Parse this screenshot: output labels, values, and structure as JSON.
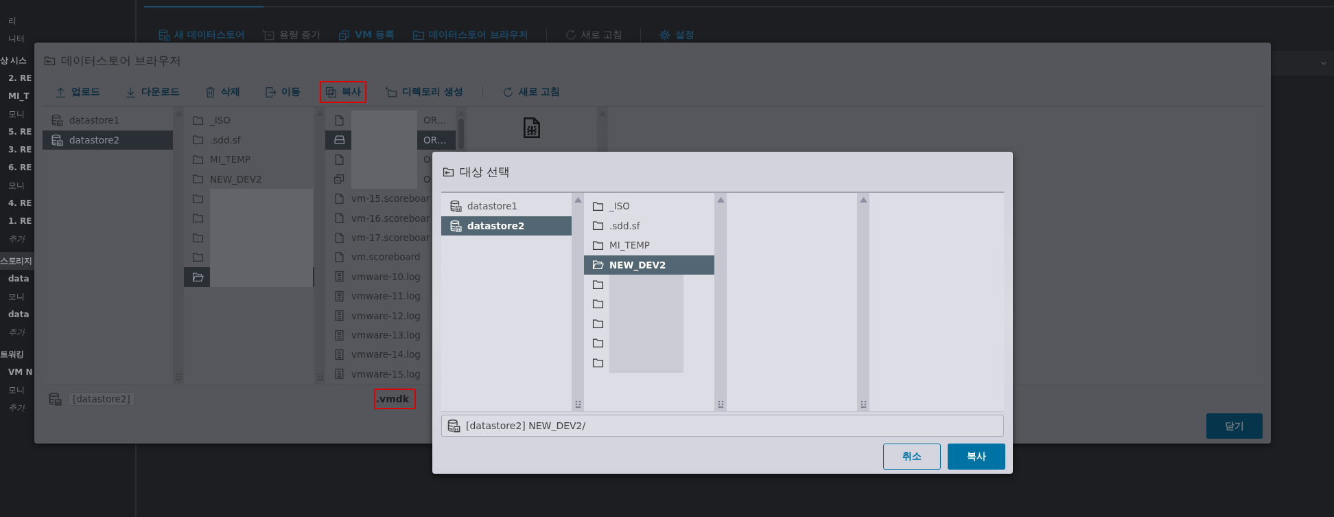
{
  "sidebar": {
    "items": [
      {
        "text": "리",
        "kind": "sub",
        "selected": false
      },
      {
        "text": "니터",
        "kind": "sub",
        "selected": false
      },
      {
        "text": "상 시스",
        "kind": "section",
        "selected": false
      },
      {
        "text": "2. RE",
        "kind": "item",
        "selected": false
      },
      {
        "text": "MI_T",
        "kind": "item",
        "selected": false
      },
      {
        "text": "모니",
        "kind": "sub",
        "selected": false
      },
      {
        "text": "5. RE",
        "kind": "item",
        "selected": false
      },
      {
        "text": "3. RE",
        "kind": "item",
        "selected": false
      },
      {
        "text": "6. RE",
        "kind": "item",
        "selected": false
      },
      {
        "text": "모니",
        "kind": "sub",
        "selected": false
      },
      {
        "text": "4. RE",
        "kind": "item",
        "selected": false
      },
      {
        "text": "1. RE",
        "kind": "item",
        "selected": false
      },
      {
        "text": "추가",
        "kind": "add",
        "selected": false
      },
      {
        "text": "스토리지",
        "kind": "section",
        "selected": true
      },
      {
        "text": "data",
        "kind": "item",
        "selected": false
      },
      {
        "text": "모니",
        "kind": "sub",
        "selected": false
      },
      {
        "text": "data",
        "kind": "item",
        "selected": false
      },
      {
        "text": "추가",
        "kind": "add",
        "selected": false
      },
      {
        "text": "트워킹",
        "kind": "section",
        "selected": false
      },
      {
        "text": "VM N",
        "kind": "item",
        "selected": false
      },
      {
        "text": "모니",
        "kind": "sub",
        "selected": false
      },
      {
        "text": "추가",
        "kind": "add",
        "selected": false
      }
    ]
  },
  "toolbar": {
    "items": [
      {
        "label": "새 데이터스토어",
        "disabled": false
      },
      {
        "label": "용량 증가",
        "disabled": true
      },
      {
        "label": "VM 등록",
        "disabled": false
      },
      {
        "label": "데이터스토어 브라우저",
        "disabled": false
      },
      {
        "label": "새로 고침",
        "disabled": true
      },
      {
        "label": "설정",
        "disabled": false
      }
    ]
  },
  "datastore_browser": {
    "title": "데이터스토어 브라우저",
    "toolbar": [
      {
        "label": "업로드",
        "highlighted": false
      },
      {
        "label": "다운로드",
        "highlighted": false
      },
      {
        "label": "삭제",
        "highlighted": false
      },
      {
        "label": "이동",
        "highlighted": false
      },
      {
        "label": "복사",
        "highlighted": true
      },
      {
        "label": "디렉토리 생성",
        "highlighted": false
      },
      {
        "label": "새로 고침",
        "highlighted": false
      }
    ],
    "datastores": [
      {
        "name": "datastore1",
        "selected": false
      },
      {
        "name": "datastore2",
        "selected": true
      }
    ],
    "folders": [
      {
        "name": "_ISO",
        "redacted": false,
        "selected": false
      },
      {
        "name": ".sdd.sf",
        "redacted": false,
        "selected": false
      },
      {
        "name": "MI_TEMP",
        "redacted": false,
        "selected": false
      },
      {
        "name": "NEW_DEV2",
        "redacted": false,
        "selected": false
      },
      {
        "redacted": true,
        "selected": false
      },
      {
        "redacted": true,
        "selected": false
      },
      {
        "redacted": true,
        "selected": false
      },
      {
        "redacted": true,
        "selected": false
      },
      {
        "redacted": true,
        "selected": true
      }
    ],
    "files": [
      {
        "kind": "file",
        "name": "OR…",
        "redacted": true,
        "selected": false
      },
      {
        "kind": "disk",
        "name": "OR…",
        "redacted": true,
        "selected": true
      },
      {
        "kind": "file",
        "name": "O",
        "redacted": true,
        "selected": false
      },
      {
        "kind": "vm",
        "name": "O",
        "redacted": true,
        "selected": false
      },
      {
        "kind": "file",
        "name": "vm-15.scoreboar",
        "redacted": false,
        "selected": false
      },
      {
        "kind": "file",
        "name": "vm-16.scoreboar",
        "redacted": false,
        "selected": false
      },
      {
        "kind": "file",
        "name": "vm-17.scoreboar",
        "redacted": false,
        "selected": false
      },
      {
        "kind": "file",
        "name": "vm.scoreboard",
        "redacted": false,
        "selected": false
      },
      {
        "kind": "log",
        "name": "vmware-10.log",
        "redacted": false,
        "selected": false
      },
      {
        "kind": "log",
        "name": "vmware-11.log",
        "redacted": false,
        "selected": false
      },
      {
        "kind": "log",
        "name": "vmware-12.log",
        "redacted": false,
        "selected": false
      },
      {
        "kind": "log",
        "name": "vmware-13.log",
        "redacted": false,
        "selected": false
      },
      {
        "kind": "log",
        "name": "vmware-14.log",
        "redacted": false,
        "selected": false
      },
      {
        "kind": "log",
        "name": "vmware-15.log",
        "redacted": false,
        "selected": false
      }
    ],
    "path": "[datastore2]",
    "file_name": {
      "text": ".vmdk",
      "highlighted": true
    },
    "close_button": "닫기"
  },
  "target_dialog": {
    "title": "대상 선택",
    "datastores": [
      {
        "name": "datastore1",
        "selected": false
      },
      {
        "name": "datastore2",
        "selected": true
      }
    ],
    "folders": [
      {
        "name": "_ISO",
        "redacted": false,
        "selected": false
      },
      {
        "name": ".sdd.sf",
        "redacted": false,
        "selected": false
      },
      {
        "name": "MI_TEMP",
        "redacted": false,
        "selected": false
      },
      {
        "name": "NEW_DEV2",
        "redacted": false,
        "selected": true
      },
      {
        "redacted": true,
        "selected": false
      },
      {
        "redacted": true,
        "selected": false
      },
      {
        "redacted": true,
        "selected": false
      },
      {
        "redacted": true,
        "selected": false
      },
      {
        "redacted": true,
        "selected": false
      }
    ],
    "path": "[datastore2] NEW_DEV2/",
    "cancel_button": "취소",
    "confirm_button": "복사"
  }
}
